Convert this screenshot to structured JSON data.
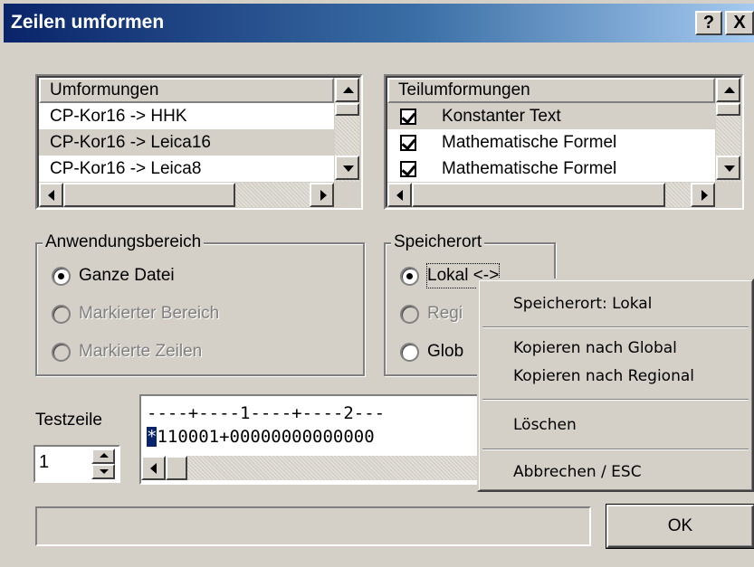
{
  "window": {
    "title": "Zeilen umformen",
    "help_label": "?",
    "close_label": "X"
  },
  "umformungen": {
    "header": "Umformungen",
    "items": [
      "CP-Kor16 -> HHK",
      "CP-Kor16 -> Leica16",
      "CP-Kor16 -> Leica8"
    ],
    "selected_index": 1
  },
  "teilumformungen": {
    "header": "Teilumformungen",
    "items": [
      {
        "label": "Konstanter Text",
        "checked": true
      },
      {
        "label": "Mathematische Formel",
        "checked": true
      },
      {
        "label": "Mathematische Formel",
        "checked": true
      }
    ],
    "selected_index": 0
  },
  "anwendungsbereich": {
    "label": "Anwendungsbereich",
    "options": [
      {
        "label": "Ganze Datei",
        "selected": true,
        "enabled": true
      },
      {
        "label": "Markierter Bereich",
        "selected": false,
        "enabled": false
      },
      {
        "label": "Markierte Zeilen",
        "selected": false,
        "enabled": false
      }
    ]
  },
  "speicherort": {
    "label": "Speicherort",
    "options": [
      {
        "label": "Lokal <->",
        "selected": true,
        "enabled": true
      },
      {
        "label": "Regi",
        "selected": false,
        "enabled": false
      },
      {
        "label": "Glob",
        "selected": false,
        "enabled": true
      }
    ]
  },
  "testzeile": {
    "label": "Testzeile",
    "value": "1",
    "ruler": "----+----1----+----2---",
    "marker": "*",
    "line": "110001+00000000000000"
  },
  "status_text": "",
  "ok_label": "OK",
  "context_menu": {
    "items": [
      "Speicherort: Lokal",
      "Kopieren nach Global",
      "Kopieren nach Regional",
      "Löschen",
      "Abbrechen / ESC"
    ]
  },
  "colors": {
    "title_start": "#0a246a",
    "title_end": "#a6caf0",
    "face": "#d4d0c8",
    "marker_bg": "#0a246a"
  }
}
